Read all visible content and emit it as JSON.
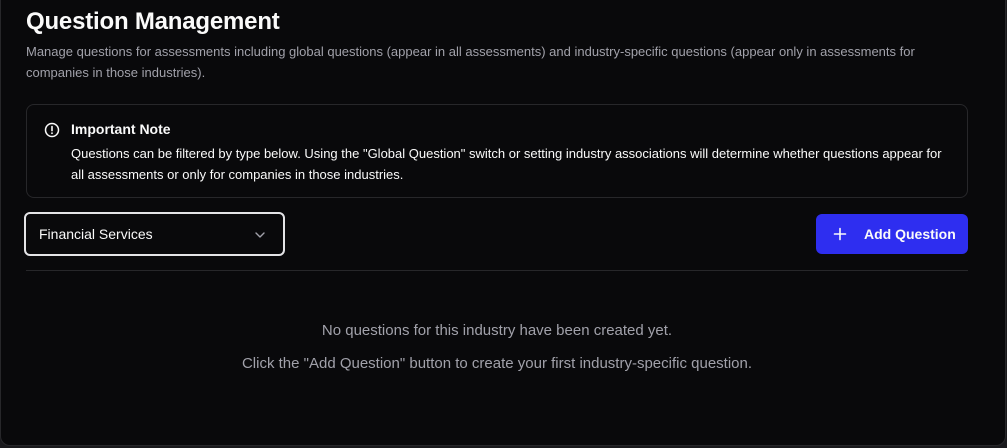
{
  "header": {
    "title": "Question Management",
    "subtitle": "Manage questions for assessments including global questions (appear in all assessments) and industry-specific questions (appear only in assessments for companies in those industries)."
  },
  "note": {
    "icon": "alert-circle-icon",
    "title": "Important Note",
    "text": "Questions can be filtered by type below. Using the \"Global Question\" switch or setting industry associations will determine whether questions appear for all assessments or only for companies in those industries."
  },
  "filter": {
    "selected": "Financial Services",
    "icon": "chevron-down-icon"
  },
  "actions": {
    "add_label": "Add Question",
    "add_icon": "plus-icon",
    "accent_color": "#2e2ef0"
  },
  "empty_state": {
    "line1": "No questions for this industry have been created yet.",
    "line2": "Click the \"Add Question\" button to create your first industry-specific question."
  }
}
